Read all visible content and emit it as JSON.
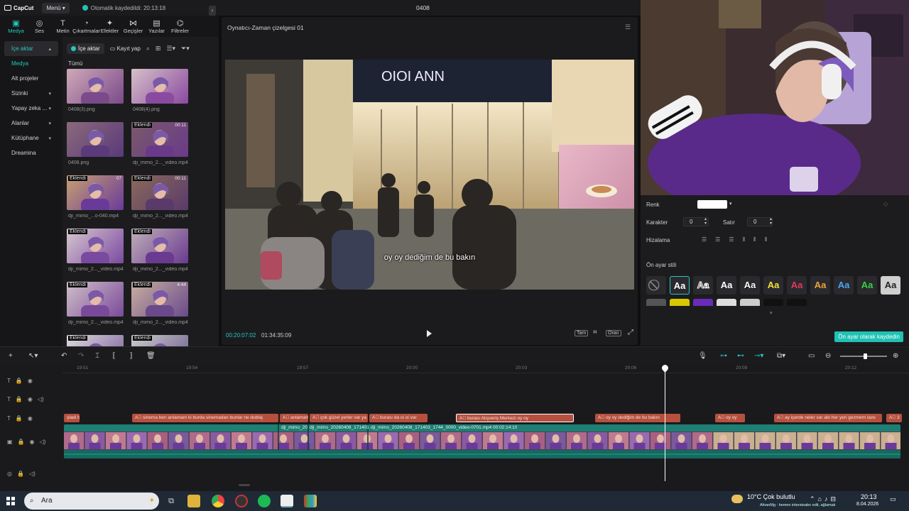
{
  "app": {
    "logo": "CapCut",
    "menu_label": "Menü",
    "autosave": "Otomatik kaydedildi: 20:13:18",
    "project_title": "0408"
  },
  "tool_tabs": [
    {
      "label": "Medya",
      "icon": "media-icon",
      "glyph": "▣"
    },
    {
      "label": "Ses",
      "icon": "audio-icon",
      "glyph": "◎"
    },
    {
      "label": "Metin",
      "icon": "text-icon",
      "glyph": "T"
    },
    {
      "label": "Çıkartmalar",
      "icon": "sticker-icon",
      "glyph": "◔"
    },
    {
      "label": "Efektler",
      "icon": "effects-icon",
      "glyph": "✦"
    },
    {
      "label": "Geçişler",
      "icon": "transition-icon",
      "glyph": "⋈"
    },
    {
      "label": "Yazılar",
      "icon": "captions-icon",
      "glyph": "▤"
    },
    {
      "label": "Filtreler",
      "icon": "filters-icon",
      "glyph": "⌬"
    }
  ],
  "left_nav": [
    {
      "label": "İçe aktar",
      "chevron": "▴"
    },
    {
      "label": "Medya",
      "chevron": ""
    },
    {
      "label": "Alt projeler",
      "chevron": ""
    },
    {
      "label": "Sizinki",
      "chevron": "▾"
    },
    {
      "label": "Yapay zeka ...",
      "chevron": "▾"
    },
    {
      "label": "Alanlar",
      "chevron": "▾"
    },
    {
      "label": "Kütüphane",
      "chevron": "▾"
    },
    {
      "label": "Dreamina",
      "chevron": ""
    }
  ],
  "media_panel": {
    "import_label": "İçe aktar",
    "record_label": "Kayıt yap",
    "all_label": "Tümü",
    "items": [
      {
        "name": "0408(3).png",
        "badge": "",
        "duration": ""
      },
      {
        "name": "0408(4).png",
        "badge": "",
        "duration": ""
      },
      {
        "name": "0408.png",
        "badge": "",
        "duration": ""
      },
      {
        "name": "dji_mimo_2..._video.mp4",
        "badge": "Eklendi",
        "duration": "00:11"
      },
      {
        "name": "dji_mimo_...o-040.mp4",
        "badge": "Eklendi",
        "duration": "07"
      },
      {
        "name": "dji_mimo_2..._video.mp4",
        "badge": "Eklendi",
        "duration": "00:11"
      },
      {
        "name": "dji_mimo_2..._video.mp4",
        "badge": "Eklendi",
        "duration": ""
      },
      {
        "name": "dji_mimo_2..._video.mp4",
        "badge": "Eklendi",
        "duration": ""
      },
      {
        "name": "dji_mimo_2..._video.mp4",
        "badge": "Eklendi",
        "duration": ""
      },
      {
        "name": "dji_mimo_2..._video.mp4",
        "badge": "Eklendi",
        "duration": "4:44"
      },
      {
        "name": "",
        "badge": "Eklendi",
        "duration": ""
      },
      {
        "name": "",
        "badge": "Eklendi",
        "duration": ""
      }
    ]
  },
  "player": {
    "title": "Oynatıcı-Zaman çizelgesi 01",
    "subtitle": "oy oy dediğim de bu bakın",
    "current_time": "00:20:07:02",
    "total_time": "01:34:35:09",
    "full_label": "Tam",
    "ratio_label": "Oran"
  },
  "properties": {
    "color_label": "Renk",
    "color_value": "#ffffff",
    "char_label": "Karakter",
    "char_value": "0",
    "line_label": "Satır",
    "line_value": "0",
    "align_label": "Hizalama",
    "preset_label": "Ön ayar stili",
    "save_preset": "Ön ayar olarak kaydedin"
  },
  "ruler_ticks": [
    "19:51",
    "19:54",
    "19:57",
    "20:00",
    "20:03",
    "20:06",
    "20:09",
    "20:12"
  ],
  "subtitle_clips": [
    {
      "text": "şladi bi",
      "selected": false
    },
    {
      "text": "A⃞ sinema ben anlamam ki burda sinemadan bunlar ne dublaj",
      "selected": false
    },
    {
      "text": "A⃞ anlamam",
      "selected": false
    },
    {
      "text": "A⃞ çok güzel yerler var ya",
      "selected": false
    },
    {
      "text": "A⃞ burası da oi oi var",
      "selected": false
    },
    {
      "text": "A⃞ burası Alışveriş Merkezi oy oy",
      "selected": true
    },
    {
      "text": "A⃞ oy oy dediğim de bu bakın",
      "selected": false
    },
    {
      "text": "A⃞ oy oy",
      "selected": false
    },
    {
      "text": "A⃞ ay içerde neler var abi her yeri gezmem laze",
      "selected": false
    },
    {
      "text": "A⃞ 3",
      "selected": false
    }
  ],
  "video_clip_labels": [
    "dji_mimo_20",
    "dji_mimo_20260408_171401_1748.0000_video",
    "dji_mimo_20260408_171403_1744_0000_video-0701.mp4  00:02:14:10"
  ],
  "taskbar": {
    "search_placeholder": "Ara",
    "weather": "10°C  Çok bulutlu",
    "time": "20:13",
    "date": "8.04.2026",
    "ticker": "AfnanMg : hemen interstealer edit, ağlamak"
  },
  "colors": {
    "accent": "#25c8bd",
    "subtitle_clip": "#b5503f",
    "video_clip": "#1e7f74"
  }
}
